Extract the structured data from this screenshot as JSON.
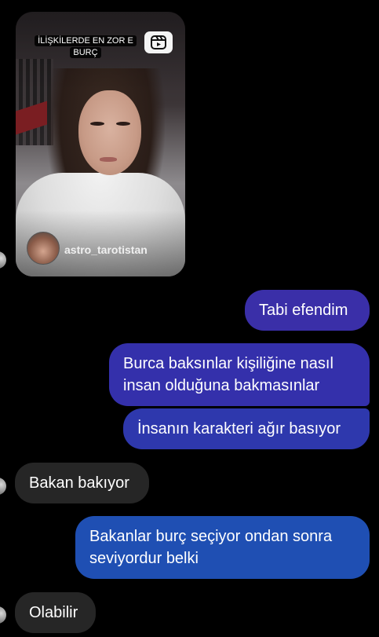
{
  "reel": {
    "caption": "İLİŞKİLERDE EN ZOR E\nBURÇ",
    "caption_line1": "İLİŞKİLERDE EN ZOR E",
    "caption_line2": "BURÇ",
    "author": "astro_tarotistan",
    "icon": "reels-icon"
  },
  "messages": [
    {
      "from": "me",
      "text": "Tabi efendim"
    },
    {
      "from": "me",
      "text": "Burca baksınlar kişiliğine nasıl insan olduğuna bakmasınlar"
    },
    {
      "from": "me",
      "text": "İnsanın karakteri ağır basıyor"
    },
    {
      "from": "them",
      "text": "Bakan bakıyor"
    },
    {
      "from": "me",
      "text": "Bakanlar burç seçiyor ondan sonra seviyordur belki"
    },
    {
      "from": "them",
      "text": "Olabilir"
    }
  ],
  "colors": {
    "background": "#000000",
    "incoming_bubble": "#262626",
    "outgoing_purple": "#3a2fa8",
    "outgoing_blue": "#1f4fb3"
  }
}
